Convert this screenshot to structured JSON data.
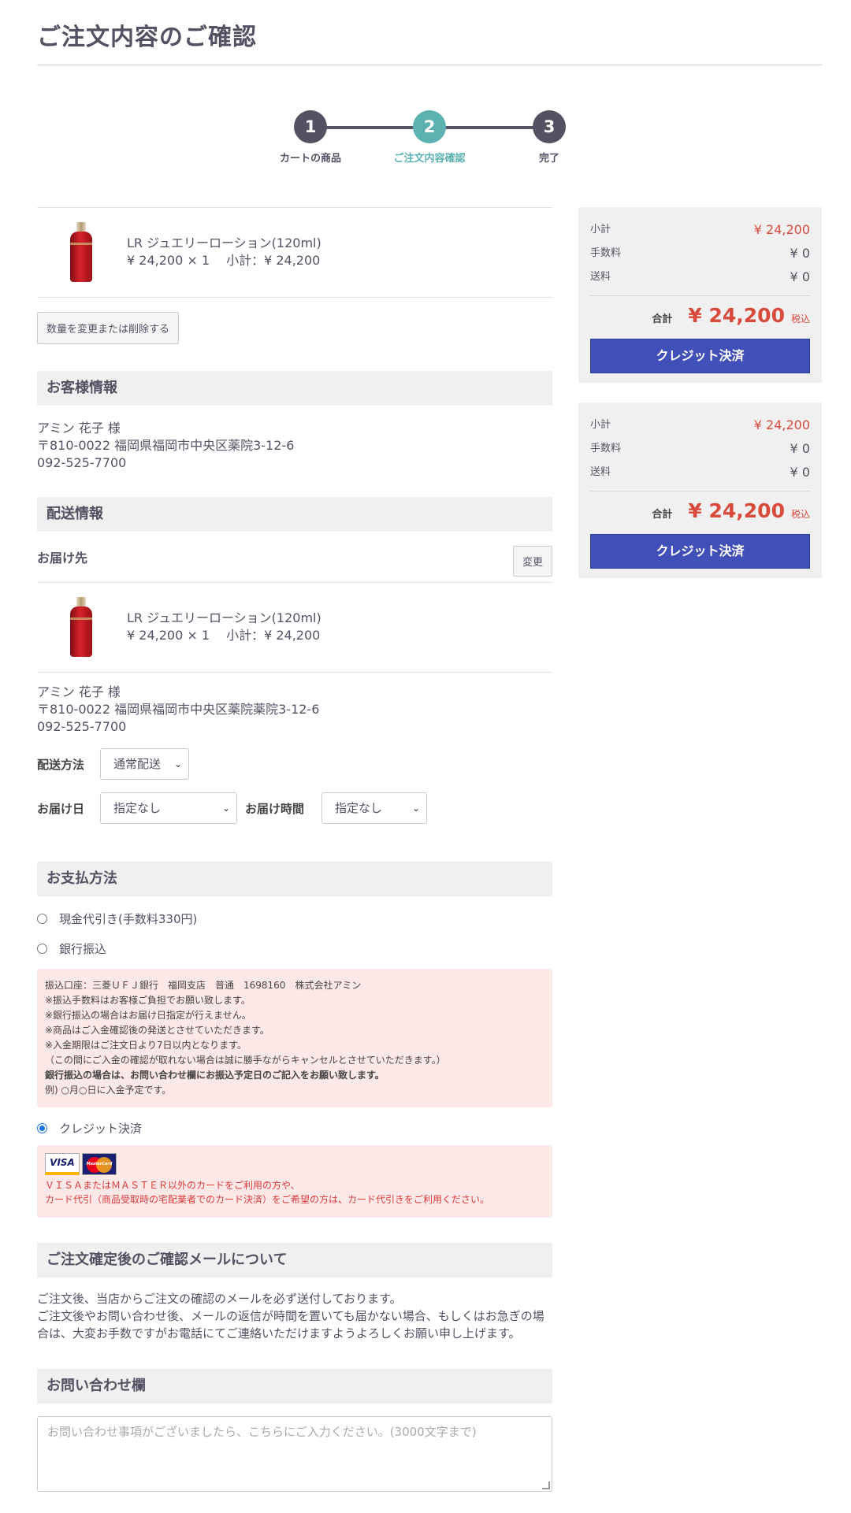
{
  "page": {
    "title": "ご注文内容のご確認"
  },
  "steps": [
    {
      "number": "1",
      "label": "カートの商品",
      "active": false
    },
    {
      "number": "2",
      "label": "ご注文内容確認",
      "active": true
    },
    {
      "number": "3",
      "label": "完了",
      "active": false
    }
  ],
  "cart": {
    "item_name": "LR ジュエリーローション(120ml)",
    "item_price_line": "¥ 24,200 × 1　 小計：¥ 24,200",
    "change_button": "数量を変更または削除する"
  },
  "customer": {
    "heading": "お客様情報",
    "name": "アミン 花子 様",
    "address": "〒810-0022 福岡県福岡市中央区薬院3-12-6",
    "phone": "092-525-7700"
  },
  "shipping": {
    "heading": "配送情報",
    "dest_label": "お届け先",
    "change_button": "変更",
    "item_name": "LR ジュエリーローション(120ml)",
    "item_price_line": "¥ 24,200 × 1　 小計：¥ 24,200",
    "name": "アミン 花子 様",
    "address": "〒810-0022 福岡県福岡市中央区薬院薬院3-12-6",
    "phone": "092-525-7700",
    "method_label": "配送方法",
    "method_value": "通常配送",
    "date_label": "お届け日",
    "date_value": "指定なし",
    "time_label": "お届け時間",
    "time_value": "指定なし"
  },
  "payment": {
    "heading": "お支払方法",
    "options": [
      {
        "label": "現金代引き(手数料330円)",
        "checked": false
      },
      {
        "label": "銀行振込",
        "checked": false
      },
      {
        "label": "クレジット決済",
        "checked": true
      }
    ],
    "bank_notes": [
      "振込口座：三菱ＵＦＪ銀行　福岡支店　普通　1698160　株式会社アミン",
      "※振込手数料はお客様ご負担でお願い致します。",
      "※銀行振込の場合はお届け日指定が行えません。",
      "※商品はご入金確認後の発送とさせていただきます。",
      "※入金期限はご注文日より7日以内となります。",
      "（この間にご入金の確認が取れない場合は誠に勝手ながらキャンセルとさせていただきます。）",
      "銀行振込の場合は、お問い合わせ欄にお振込予定日のご記入をお願い致します。",
      "例) ○月○日に入金予定です。"
    ],
    "card_visa": "VISA",
    "card_master": "MasterCard",
    "credit_note_1": "ＶＩＳＡまたはＭＡＳＴＥＲ以外のカードをご利用の方や、",
    "credit_note_2": "カード代引（商品受取時の宅配業者でのカード決済）をご希望の方は、カード代引きをご利用ください。"
  },
  "mail_notice": {
    "heading": "ご注文確定後のご確認メールについて",
    "line1": "ご注文後、当店からご注文の確認のメールを必ず送付しております。",
    "line2": "ご注文後やお問い合わせ後、メールの返信が時間を置いても届かない場合、もしくはお急ぎの場合は、大変お手数ですがお電話にてご連絡いただけますようよろしくお願い申し上げます。"
  },
  "inquiry": {
    "heading": "お問い合わせ欄",
    "placeholder": "お問い合わせ事項がございましたら、こちらにご入力ください。(3000文字まで)"
  },
  "summary": {
    "subtotal_label": "小計",
    "subtotal_value": "¥ 24,200",
    "fee_label": "手数料",
    "fee_value": "¥ 0",
    "shipping_label": "送料",
    "shipping_value": "¥ 0",
    "total_label": "合計",
    "total_value": "¥ 24,200",
    "tax_label": "税込",
    "pay_button": "クレジット決済"
  },
  "colors": {
    "accent_teal": "#5cb1b1",
    "step_dark": "#525263",
    "price_red": "#d94a3b",
    "pay_button_blue": "#4150b8",
    "notice_pink": "#fde8e8"
  }
}
